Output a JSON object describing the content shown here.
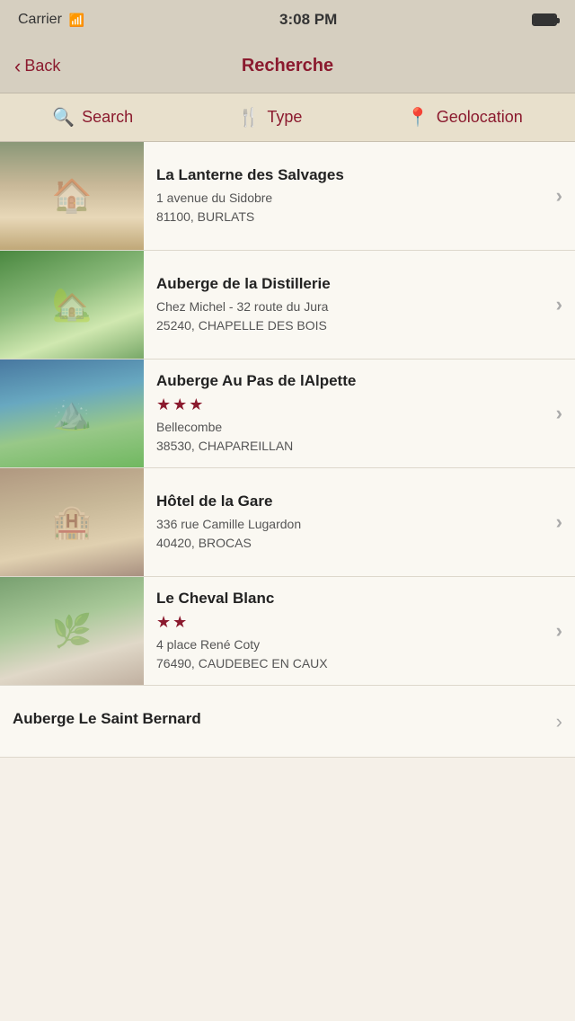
{
  "statusBar": {
    "carrier": "Carrier",
    "time": "3:08 PM"
  },
  "navBar": {
    "backLabel": "Back",
    "title": "Recherche"
  },
  "tabs": [
    {
      "id": "search",
      "label": "Search",
      "icon": "🔍"
    },
    {
      "id": "type",
      "label": "Type",
      "icon": "🍴"
    },
    {
      "id": "geolocation",
      "label": "Geolocation",
      "icon": "📍"
    }
  ],
  "listings": [
    {
      "id": "lanterne",
      "name": "La Lanterne des Salvages",
      "stars": 0,
      "address_line1": "1 avenue du Sidobre",
      "address_line2": "81100, BURLATS",
      "imgClass": "img-lanterne"
    },
    {
      "id": "distillerie",
      "name": "Auberge de la Distillerie",
      "stars": 0,
      "address_line1": "Chez Michel - 32 route du Jura",
      "address_line2": "25240, CHAPELLE DES BOIS",
      "imgClass": "img-distillerie"
    },
    {
      "id": "alpette",
      "name": "Auberge Au Pas de lAlpette",
      "stars": 3,
      "address_line1": "Bellecombe",
      "address_line2": "38530, CHAPAREILLAN",
      "imgClass": "img-alpette"
    },
    {
      "id": "gare",
      "name": "Hôtel de la Gare",
      "stars": 0,
      "address_line1": "336 rue Camille Lugardon",
      "address_line2": "40420, BROCAS",
      "imgClass": "img-gare"
    },
    {
      "id": "cheval-blanc",
      "name": "Le Cheval Blanc",
      "stars": 2,
      "address_line1": "4 place René Coty",
      "address_line2": "76490, CAUDEBEC EN CAUX",
      "imgClass": "img-cheval"
    },
    {
      "id": "saint-bernard",
      "name": "Auberge Le Saint Bernard",
      "stars": 0,
      "address_line1": "",
      "address_line2": "",
      "imgClass": "img-saint-bernard",
      "partial": true
    }
  ]
}
